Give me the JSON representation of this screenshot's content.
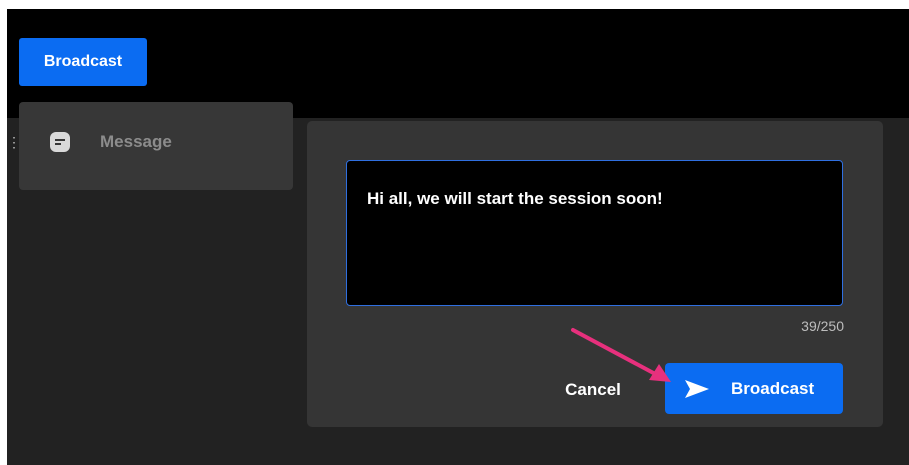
{
  "header": {
    "broadcast_label": "Broadcast"
  },
  "menu": {
    "items": [
      {
        "label": "Message",
        "icon": "message-icon"
      }
    ]
  },
  "composer": {
    "message_value": "Hi all, we will start the session soon!",
    "char_count": "39/250",
    "cancel_label": "Cancel",
    "broadcast_label": "Broadcast",
    "send_icon": "send-icon"
  },
  "colors": {
    "accent_blue": "#0b6cf2",
    "annotation_arrow": "#e7307d"
  }
}
